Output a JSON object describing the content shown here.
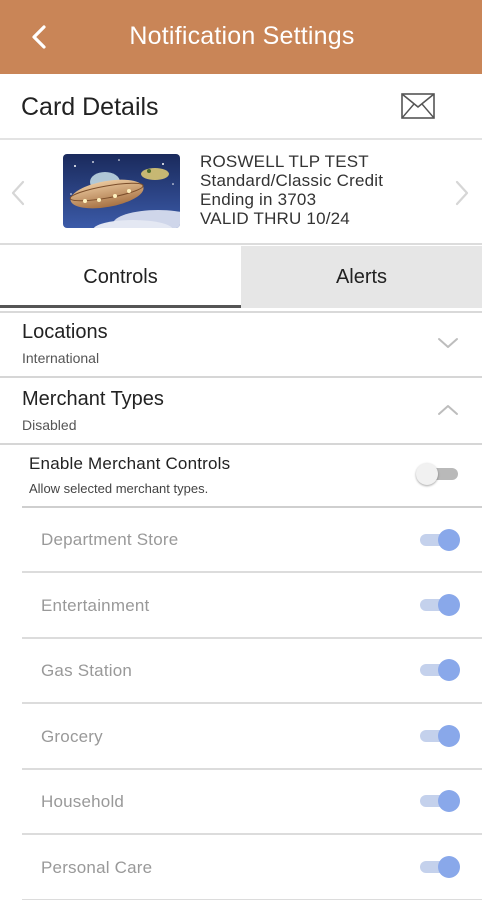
{
  "app_bar": {
    "title": "Notification Settings",
    "back_icon": "back-chevron-icon"
  },
  "card_header": {
    "label": "Card Details",
    "mail_icon": "envelope-icon"
  },
  "card": {
    "name": "ROSWELL TLP TEST",
    "type": "Standard/Classic Credit",
    "ending": "Ending in 3703",
    "valid": "VALID THRU 10/24",
    "image": "ufo-card-image"
  },
  "tabs": [
    {
      "label": "Controls",
      "selected": true
    },
    {
      "label": "Alerts",
      "selected": false
    }
  ],
  "sections": [
    {
      "title": "Locations",
      "subtitle": "International",
      "expanded": false
    },
    {
      "title": "Merchant Types",
      "subtitle": "Disabled",
      "expanded": true
    }
  ],
  "enable_merchant": {
    "title": "Enable Merchant Controls",
    "subtitle": "Allow selected merchant types.",
    "on": false
  },
  "merchant_types": [
    {
      "label": "Department Store",
      "on": true
    },
    {
      "label": "Entertainment",
      "on": true
    },
    {
      "label": "Gas Station",
      "on": true
    },
    {
      "label": "Grocery",
      "on": true
    },
    {
      "label": "Household",
      "on": true
    },
    {
      "label": "Personal Care",
      "on": true
    }
  ],
  "colors": {
    "app_bar": "#c98557",
    "toggle_on_knob": "#89a8ea",
    "toggle_on_track": "#c4d1ec",
    "toggle_off_track": "#b9b9b9",
    "tab_inactive_bg": "#e6e6e6"
  }
}
